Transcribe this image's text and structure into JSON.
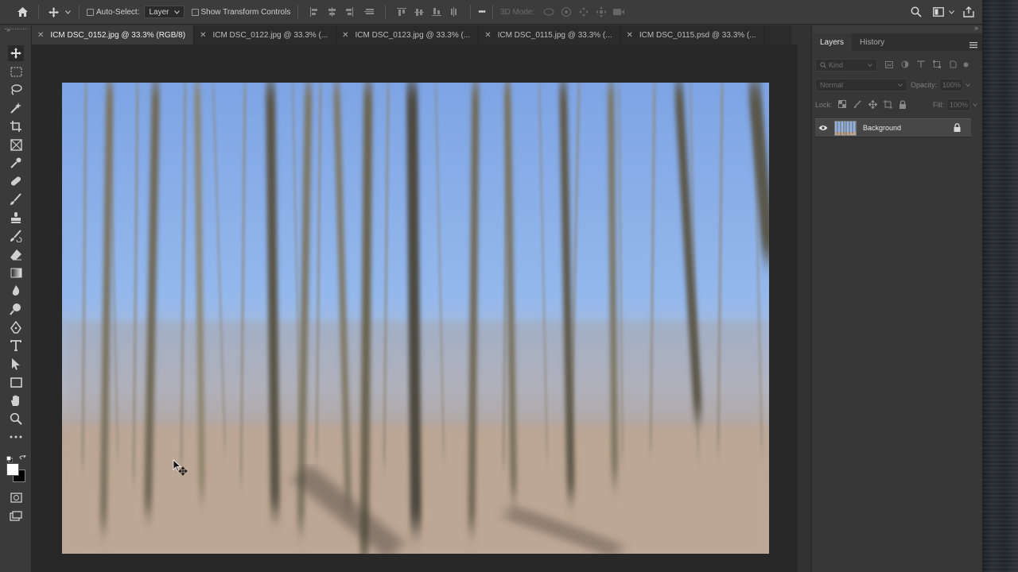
{
  "options_bar": {
    "home_icon": "home-icon",
    "move_tool_icon": "move-tool-icon",
    "auto_select_label": "Auto-Select:",
    "auto_select_target": "Layer",
    "show_transform_label": "Show Transform Controls",
    "more_label": "•••",
    "three_d_mode_label": "3D Mode:"
  },
  "tabs": [
    {
      "label": "ICM DSC_0152.jpg @ 33.3% (RGB/8)",
      "active": true
    },
    {
      "label": "ICM DSC_0122.jpg @ 33.3% (..."
    },
    {
      "label": "ICM DSC_0123.jpg @ 33.3% (..."
    },
    {
      "label": "ICM DSC_0115.jpg @ 33.3% (..."
    },
    {
      "label": "ICM DSC_0115.psd @ 33.3% (..."
    }
  ],
  "tools": [
    "move-tool",
    "marquee-tool",
    "lasso-tool",
    "quick-select-tool",
    "crop-tool",
    "frame-tool",
    "eyedropper-tool",
    "healing-brush-tool",
    "brush-tool",
    "clone-stamp-tool",
    "history-brush-tool",
    "eraser-tool",
    "gradient-tool",
    "blur-tool",
    "dodge-tool",
    "pen-tool",
    "type-tool",
    "path-select-tool",
    "rectangle-tool",
    "hand-tool",
    "zoom-tool",
    "edit-toolbar"
  ],
  "panel": {
    "tabs": [
      "Layers",
      "History"
    ],
    "kind_placeholder": "Kind",
    "blend_mode": "Normal",
    "opacity_label": "Opacity:",
    "opacity_value": "100%",
    "lock_label": "Lock:",
    "fill_label": "Fill:",
    "fill_value": "100%",
    "layer_name": "Background"
  },
  "colors": {
    "foreground": "#ffffff",
    "background": "#000000",
    "sky": "#8db2ea",
    "ground": "#b8a595"
  }
}
